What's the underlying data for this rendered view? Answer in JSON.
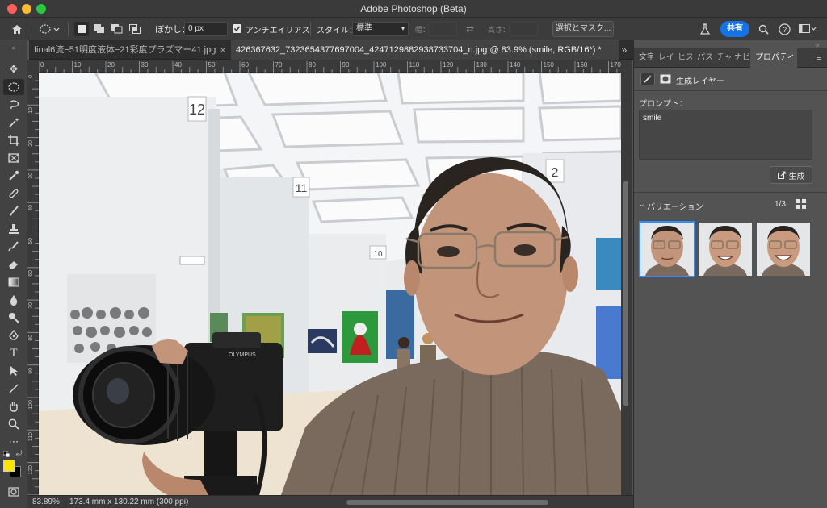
{
  "window": {
    "title": "Adobe Photoshop (Beta)"
  },
  "options_bar": {
    "feather_label": "ぼかし：",
    "feather_value": "0 px",
    "antialias_label": "アンチエイリアス",
    "antialias_checked": true,
    "style_label": "スタイル：",
    "style_value": "標準",
    "width_label": "幅：",
    "height_label": "高さ：",
    "select_mask_label": "選択とマスク...",
    "share_label": "共有"
  },
  "tabs": [
    {
      "label": "final6流−51明度液体−21彩度プラズマー41.jpg",
      "active": false
    },
    {
      "label": "426367632_7323654377697004_4247129882938733704_n.jpg @ 83.9% (smile, RGB/16*) *",
      "active": true
    }
  ],
  "ruler": {
    "marks": [
      "0",
      "10",
      "20",
      "30",
      "40",
      "50",
      "60",
      "70",
      "80",
      "90",
      "100",
      "110",
      "120",
      "130",
      "140",
      "150",
      "160",
      "170"
    ]
  },
  "ruler_v": {
    "marks": [
      "0",
      "10",
      "20",
      "30",
      "40",
      "50",
      "60",
      "70",
      "80",
      "90",
      "100",
      "110",
      "120",
      "130"
    ]
  },
  "status": {
    "zoom": "83.89%",
    "doc_info": "173.4 mm x 130.22 mm (300 ppi)"
  },
  "panel": {
    "tabs": [
      "文字",
      "レイ",
      "ヒス",
      "パス",
      "チャ",
      "ナビ",
      "プロパティ"
    ],
    "header": "生成レイヤー",
    "prompt_label": "プロンプト：",
    "prompt_value": "smile",
    "generate_label": "生成",
    "variations_label": "バリエーション",
    "variation_count": "1/3",
    "selected_variation": 1
  },
  "canvas": {
    "room_numbers": [
      "12",
      "11",
      "2",
      "10"
    ]
  },
  "colors": {
    "accent": "#1473e6",
    "foreground_swatch": "#ffe400",
    "background_swatch": "#000000"
  }
}
